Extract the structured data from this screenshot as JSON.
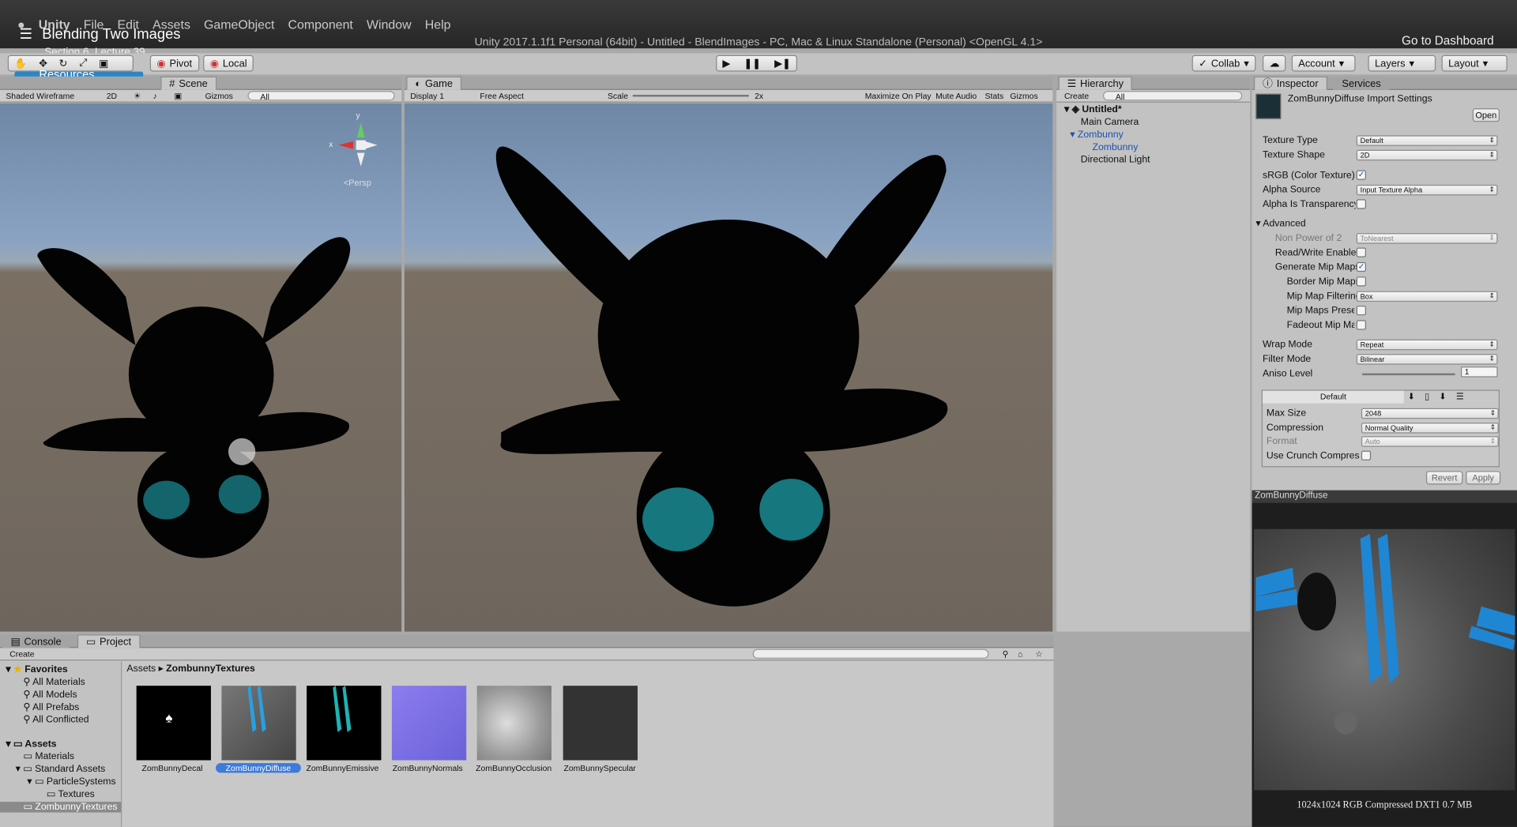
{
  "overlay": {
    "title": "Blending Two Images",
    "subtitle": "Section 6, Lecture 39",
    "resources": "Resources available",
    "dashboard": "Go to Dashboard"
  },
  "menu": {
    "app": "Unity",
    "items": [
      "File",
      "Edit",
      "Assets",
      "GameObject",
      "Component",
      "Window",
      "Help"
    ]
  },
  "window_title": "Unity 2017.1.1f1 Personal (64bit) - Untitled - BlendImages - PC, Mac & Linux Standalone (Personal) <OpenGL 4.1>",
  "toolbar": {
    "pivot": "Pivot",
    "local": "Local",
    "collab": "Collab",
    "account": "Account",
    "layers": "Layers",
    "layout": "Layout"
  },
  "scene": {
    "tab": "Scene",
    "shading": "Shaded Wireframe",
    "mode2d": "2D",
    "gizmos": "Gizmos",
    "search_placeholder": "All",
    "persp": "Persp",
    "axis_x": "x",
    "axis_y": "y"
  },
  "game": {
    "tab": "Game",
    "display": "Display 1",
    "aspect": "Free Aspect",
    "scale_label": "Scale",
    "scale_value": "2x",
    "maximize": "Maximize On Play",
    "mute": "Mute Audio",
    "stats": "Stats",
    "gizmos": "Gizmos"
  },
  "hierarchy": {
    "tab": "Hierarchy",
    "create": "Create",
    "search_placeholder": "All",
    "scene": "Untitled*",
    "items": [
      "Main Camera",
      "Zombunny",
      "Zombunny",
      "Directional Light"
    ]
  },
  "inspector": {
    "tab": "Inspector",
    "services": "Services",
    "title": "ZomBunnyDiffuse Import Settings",
    "open": "Open",
    "texture_type_label": "Texture Type",
    "texture_type": "Default",
    "texture_shape_label": "Texture Shape",
    "texture_shape": "2D",
    "srgb": "sRGB (Color Texture)",
    "alpha_source_label": "Alpha Source",
    "alpha_source": "Input Texture Alpha",
    "alpha_transp": "Alpha Is Transparency",
    "advanced": "Advanced",
    "npot_label": "Non Power of 2",
    "npot": "ToNearest",
    "rw": "Read/Write Enabled",
    "genmip": "Generate Mip Maps",
    "bordermip": "Border Mip Maps",
    "mipfilter_label": "Mip Map Filtering",
    "mipfilter": "Box",
    "mippreserve": "Mip Maps Preserve",
    "fademip": "Fadeout Mip Maps",
    "wrap_label": "Wrap Mode",
    "wrap": "Repeat",
    "filter_label": "Filter Mode",
    "filter": "Bilinear",
    "aniso_label": "Aniso Level",
    "aniso": "1",
    "platform": "Default",
    "maxsize_label": "Max Size",
    "maxsize": "2048",
    "compression_label": "Compression",
    "compression": "Normal Quality",
    "format_label": "Format",
    "format": "Auto",
    "crunch": "Use Crunch Compression",
    "revert": "Revert",
    "apply": "Apply",
    "preview_name": "ZomBunnyDiffuse",
    "preview_info": "1024x1024  RGB Compressed DXT1   0.7 MB"
  },
  "bottom": {
    "console": "Console",
    "project": "Project",
    "create": "Create",
    "favorites": "Favorites",
    "fav_items": [
      "All Materials",
      "All Models",
      "All Prefabs",
      "All Conflicted"
    ],
    "assets": "Assets",
    "asset_items": [
      "Materials",
      "Standard Assets",
      "ParticleSystems",
      "Textures",
      "ZombunnyTextures"
    ],
    "breadcrumb_root": "Assets",
    "breadcrumb_leaf": "ZombunnyTextures",
    "thumbs": [
      "ZomBunnyDecal",
      "ZomBunnyDiffuse",
      "ZomBunnyEmissive",
      "ZomBunnyNormals",
      "ZomBunnyOcclusion",
      "ZomBunnySpecular"
    ]
  },
  "colors": {
    "accent": "#2a86c7",
    "selection": "#3c7bd9",
    "teal": "#19b5c8"
  }
}
